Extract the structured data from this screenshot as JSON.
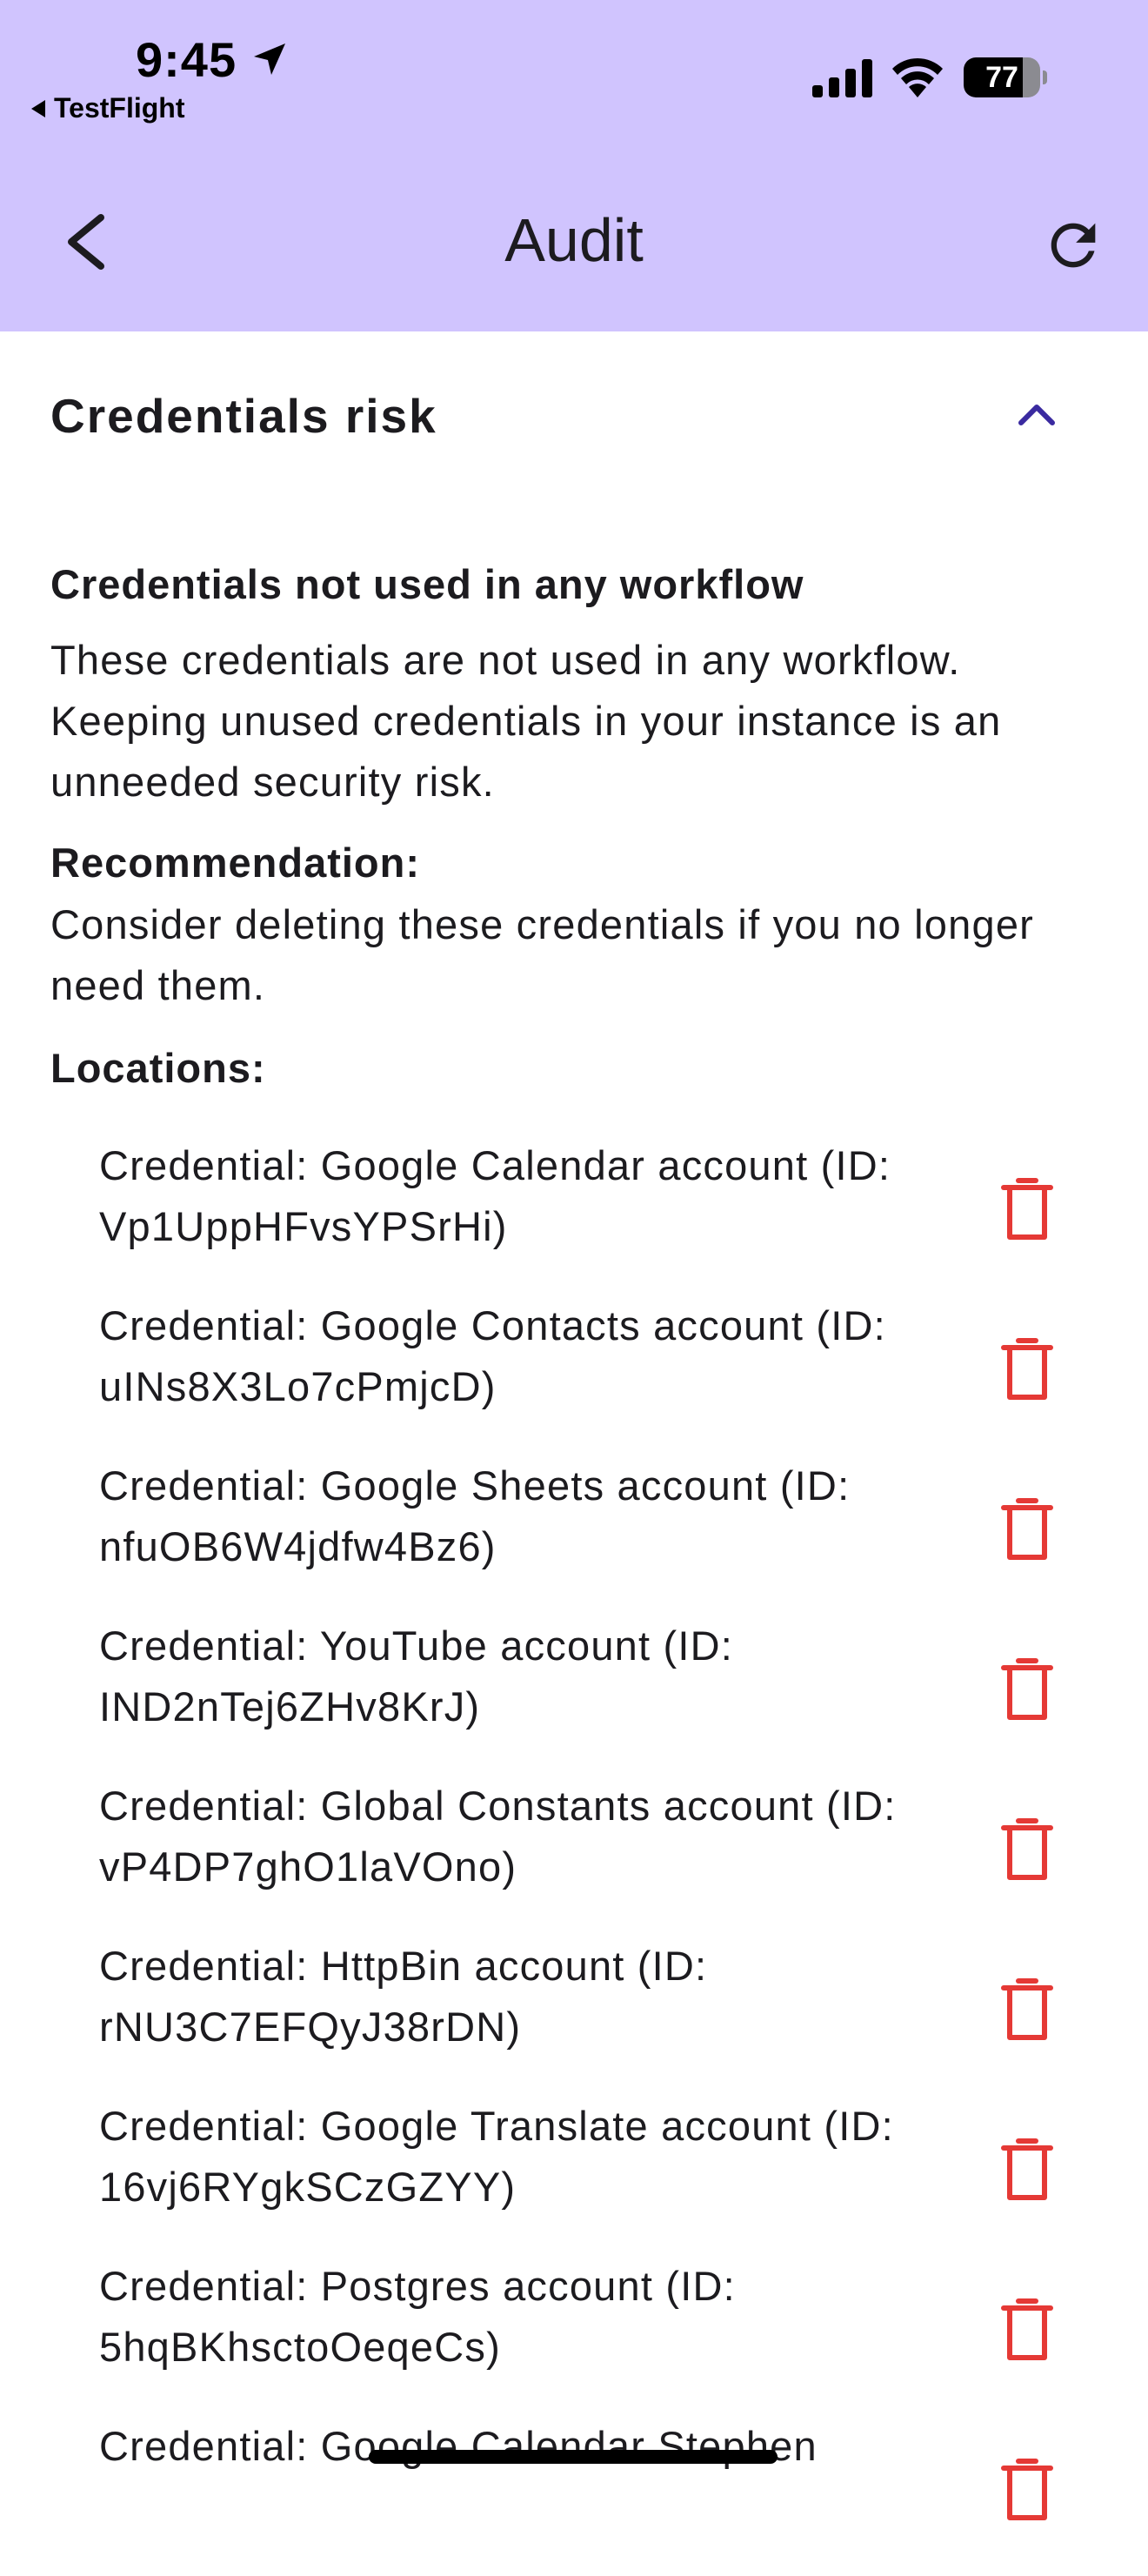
{
  "status_bar": {
    "time": "9:45",
    "back_app": "TestFlight",
    "battery_level": "77",
    "battery_percent": 77
  },
  "app_bar": {
    "title": "Audit",
    "background": "#d0c4fe"
  },
  "section": {
    "title": "Credentials risk",
    "expanded": true,
    "accent": "#3a2aa0"
  },
  "risk": {
    "heading": "Credentials not used in any workflow",
    "description": "These credentials are not used in any workflow. Keeping unused credentials in your instance is an unneeded security risk.",
    "recommendation_label": "Recommendation:",
    "recommendation": "Consider deleting these credentials if you no longer need them.",
    "locations_label": "Locations:"
  },
  "locations": [
    {
      "text": "Credential: Google Calendar account (ID: Vp1UppHFvsYPSrHi)"
    },
    {
      "text": "Credential: Google Contacts account (ID: uINs8X3Lo7cPmjcD)"
    },
    {
      "text": "Credential: Google Sheets account (ID: nfuOB6W4jdfw4Bz6)"
    },
    {
      "text": "Credential: YouTube account (ID: IND2nTej6ZHv8KrJ)"
    },
    {
      "text": "Credential: Global Constants account (ID: vP4DP7ghO1laVOno)"
    },
    {
      "text": "Credential: HttpBin account (ID: rNU3C7EFQyJ38rDN)"
    },
    {
      "text": "Credential: Google Translate account (ID: 16vj6RYgkSCzGZYY)"
    },
    {
      "text": "Credential: Postgres account (ID: 5hqBKhsctoOeqeCs)"
    },
    {
      "text": "Credential: Google Calendar Stephen"
    }
  ],
  "icons": {
    "delete": "trash-icon",
    "delete_color": "#e53935",
    "refresh": "refresh-icon",
    "back": "chevron-left-icon",
    "collapse": "chevron-up-icon"
  }
}
